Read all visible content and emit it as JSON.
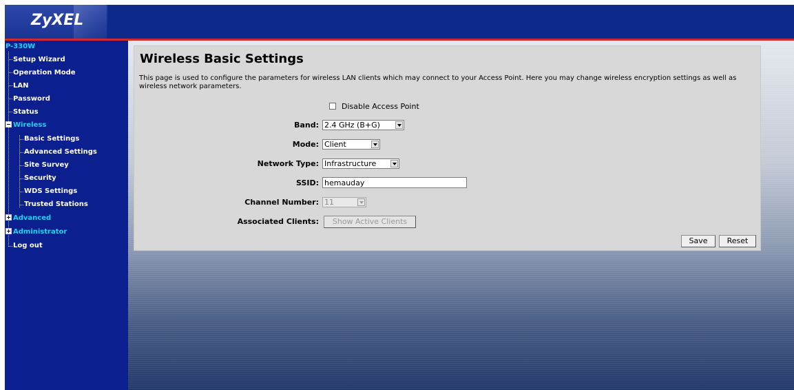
{
  "header": {
    "logo_text": "ZyXEL"
  },
  "sidebar": {
    "root": "P-330W",
    "items": [
      {
        "label": "Setup Wizard"
      },
      {
        "label": "Operation Mode"
      },
      {
        "label": "LAN"
      },
      {
        "label": "Password"
      },
      {
        "label": "Status"
      },
      {
        "label": "Wireless"
      },
      {
        "label": "Basic Settings"
      },
      {
        "label": "Advanced Settings"
      },
      {
        "label": "Site Survey"
      },
      {
        "label": "Security"
      },
      {
        "label": "WDS Settings"
      },
      {
        "label": "Trusted Stations"
      },
      {
        "label": "Advanced"
      },
      {
        "label": "Administrator"
      },
      {
        "label": "Log out"
      }
    ]
  },
  "page": {
    "title": "Wireless Basic Settings",
    "description": "This page is used to configure the parameters for wireless LAN clients which may connect to your Access Point. Here you may change wireless encryption settings as well as wireless network parameters."
  },
  "form": {
    "disable_ap_label": "Disable Access Point",
    "disable_ap_checked": false,
    "band_label": "Band:",
    "band_value": "2.4 GHz (B+G)",
    "mode_label": "Mode:",
    "mode_value": "Client",
    "network_type_label": "Network Type:",
    "network_type_value": "Infrastructure",
    "ssid_label": "SSID:",
    "ssid_value": "hemauday",
    "channel_label": "Channel Number:",
    "channel_value": "11",
    "assoc_label": "Associated Clients:",
    "assoc_button": "Show Active Clients"
  },
  "actions": {
    "save": "Save",
    "reset": "Reset"
  },
  "colors": {
    "header_bg": "#0d2a8a",
    "sidebar_bg": "#0b1f8f",
    "accent_red": "#d12a2a",
    "active_nav": "#19d3f0"
  }
}
